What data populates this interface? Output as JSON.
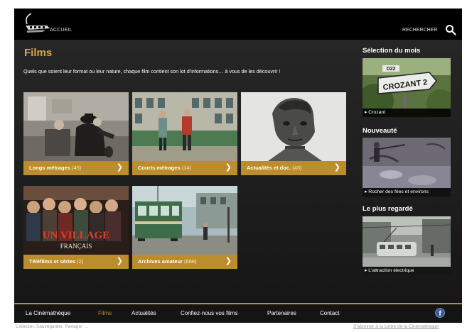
{
  "header": {
    "home_label": "ACCUEIL",
    "search_label": "RECHERCHER",
    "logo_icon": "cinematheque-logo",
    "search_icon": "search-icon"
  },
  "main": {
    "title": "Films",
    "intro": "Quels que soient leur format ou leur nature, chaque film contient son lot d'informations… à vous de les découvrir !",
    "categories": [
      {
        "label": "Longs métrages",
        "count": "(45)"
      },
      {
        "label": "Courts métrages",
        "count": "(14)"
      },
      {
        "label": "Actualités et doc.",
        "count": "(43)"
      },
      {
        "label": "Téléfilms et séries",
        "count": "(2)"
      },
      {
        "label": "Archives amateur",
        "count": "(688)"
      }
    ],
    "poster_text": {
      "line1": "UN VILLAGE",
      "line2": "FRANÇAIS"
    }
  },
  "sidebar": {
    "selection": {
      "title": "Sélection du mois",
      "caption": "▸ Crozant",
      "sign_text": "CROZANT 2",
      "plate_text": "D22"
    },
    "nouveaute": {
      "title": "Nouveauté",
      "caption": "▸ Rocher des fées et environs"
    },
    "plus_regarde": {
      "title": "Le plus regardé",
      "caption": "▸ L'attraction électrique"
    }
  },
  "footer": {
    "nav": [
      "La Cinémathèque",
      "Films",
      "Actualités",
      "Confiez-nous vos films",
      "Partenaires",
      "Contact"
    ],
    "active_item": "Films",
    "facebook_icon": "facebook-icon"
  },
  "bottom": {
    "left_text": "Collecter, Sauvegarder, Partager …",
    "right_link": "S'abonner à la Lettre de la Cinémathèque"
  },
  "colors": {
    "accent_gold": "#bb8d2d",
    "title_gold": "#d8a84a",
    "background": "#000000"
  }
}
